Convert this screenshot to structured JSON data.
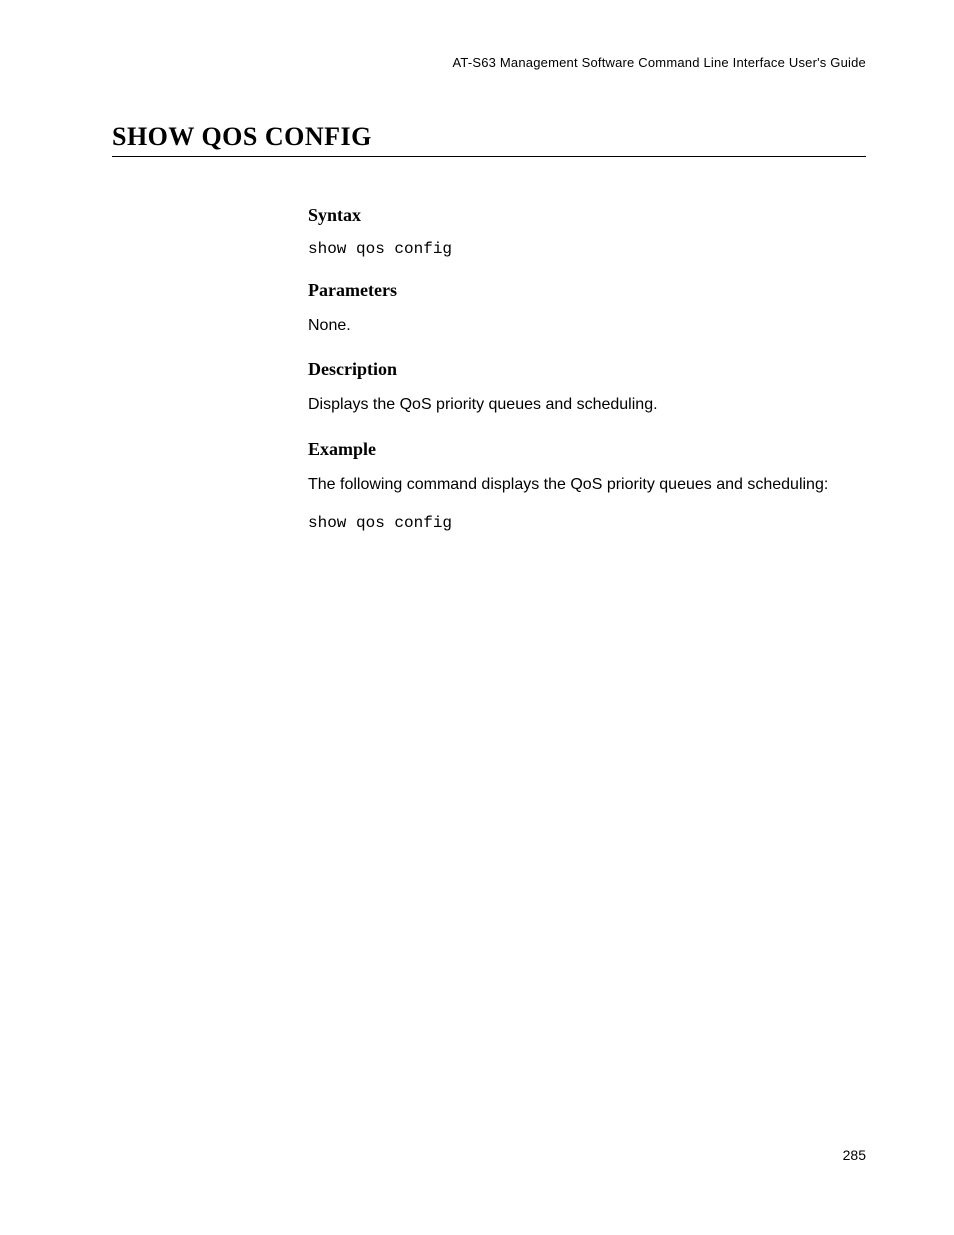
{
  "header": {
    "document_title": "AT-S63 Management Software Command Line Interface User's Guide"
  },
  "title": "SHOW QOS CONFIG",
  "sections": {
    "syntax": {
      "heading": "Syntax",
      "command": "show qos config"
    },
    "parameters": {
      "heading": "Parameters",
      "text": "None."
    },
    "description": {
      "heading": "Description",
      "text": "Displays the QoS priority queues and scheduling."
    },
    "example": {
      "heading": "Example",
      "text": "The following command displays the QoS priority queues and scheduling:",
      "command": "show qos config"
    }
  },
  "page_number": "285"
}
